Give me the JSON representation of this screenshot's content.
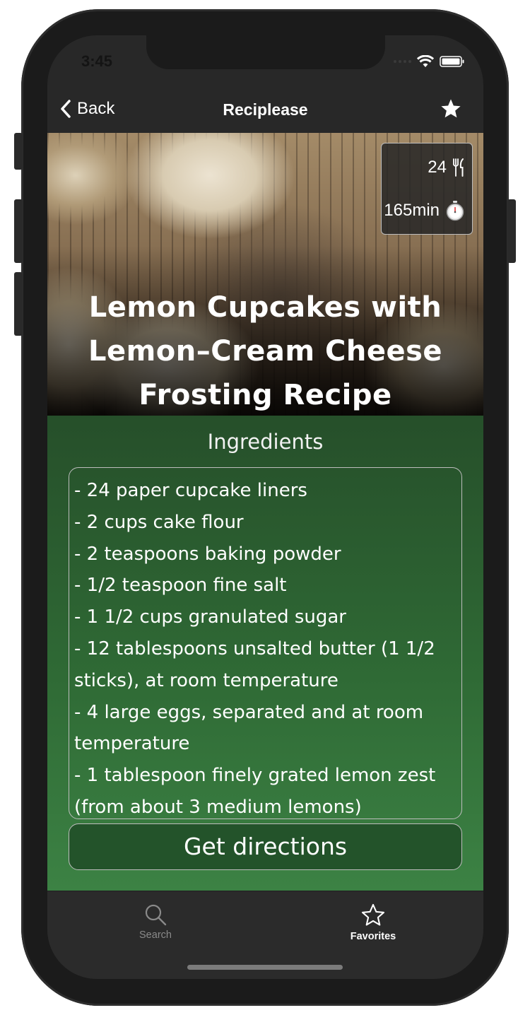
{
  "status_bar": {
    "time": "3:45"
  },
  "nav": {
    "back_label": "Back",
    "title": "Reciplease"
  },
  "recipe": {
    "servings": "24",
    "time": "165min",
    "title": "Lemon Cupcakes with Lemon–Cream Cheese Frosting Recipe"
  },
  "ingredients": {
    "heading": "Ingredients",
    "items": [
      "- 24 paper cupcake liners",
      "- 2 cups cake flour",
      "- 2 teaspoons baking powder",
      "- 1/2 teaspoon fine salt",
      "- 1 1/2 cups granulated sugar",
      "- 12 tablespoons unsalted butter (1 1/2 sticks), at room temperature",
      "- 4 large eggs, separated and at room temperature",
      "- 1 tablespoon finely grated lemon zest (from about 3 medium lemons)"
    ]
  },
  "actions": {
    "directions_label": "Get directions"
  },
  "tabbar": {
    "search_label": "Search",
    "favorites_label": "Favorites",
    "selected": "Favorites"
  },
  "colors": {
    "content_green_top": "#264f2a",
    "content_green_bottom": "#3c8244",
    "button_green": "#23532a",
    "bar_dark": "#282828"
  },
  "icons": [
    "chevron-left-icon",
    "star-filled-icon",
    "fork-knife-icon",
    "stopwatch-icon",
    "magnifier-icon",
    "star-outline-icon",
    "wifi-icon",
    "battery-icon"
  ]
}
